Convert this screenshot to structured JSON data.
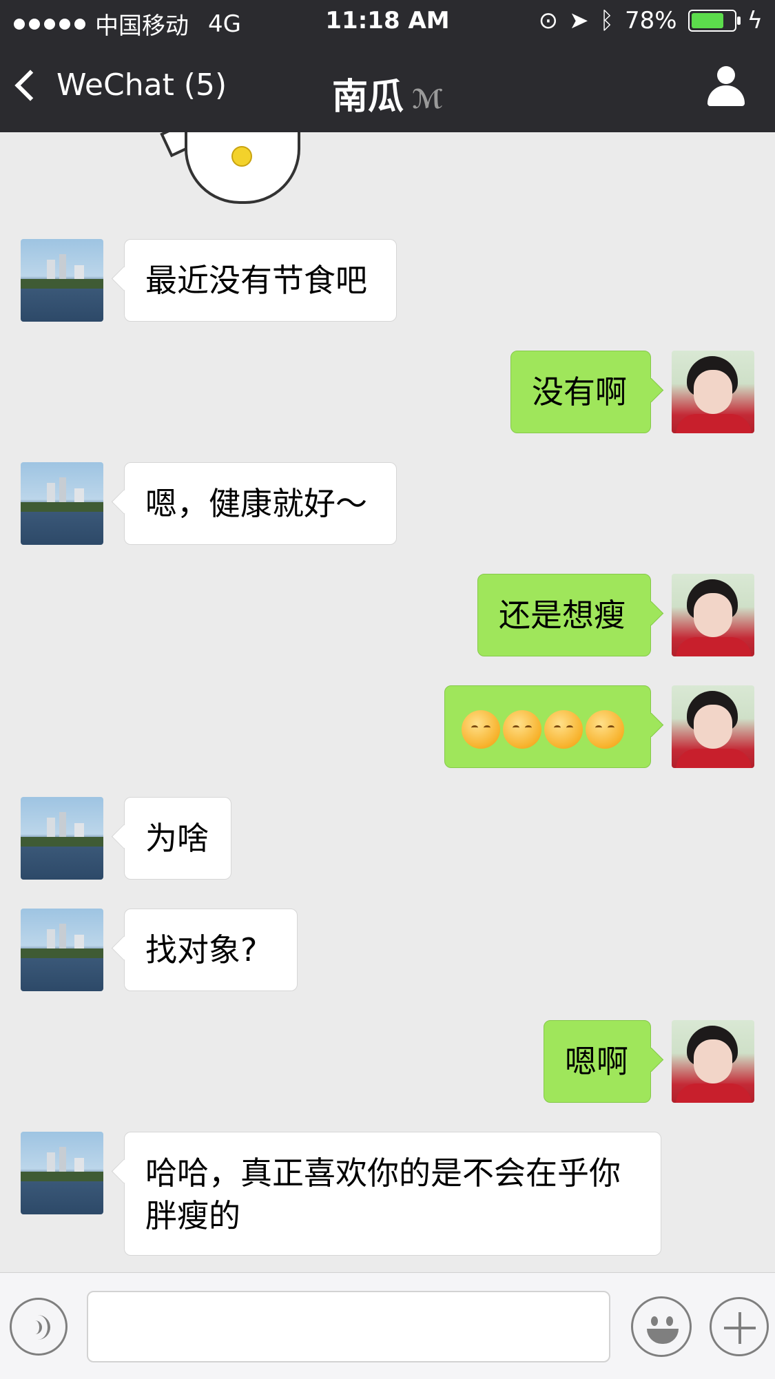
{
  "status_bar": {
    "carrier": "中国移动",
    "network": "4G",
    "time": "11:18 AM",
    "battery": "78%",
    "battery_level": 0.78
  },
  "nav": {
    "back_label": "WeChat (5)",
    "title": "南瓜"
  },
  "messages": [
    {
      "side": "left",
      "text": "最近没有节食吧"
    },
    {
      "side": "right",
      "text": "没有啊"
    },
    {
      "side": "left",
      "text": "嗯，健康就好～"
    },
    {
      "side": "right",
      "text": "还是想瘦"
    },
    {
      "side": "right",
      "type": "emoji",
      "emoji_name": "relieved-face",
      "count": 4
    },
    {
      "side": "left",
      "text": "为啥"
    },
    {
      "side": "left",
      "text": "找对象?"
    },
    {
      "side": "right",
      "text": "嗯啊"
    },
    {
      "side": "left",
      "text": "哈哈，真正喜欢你的是不会在乎你\n胖瘦的"
    }
  ],
  "input_bar": {
    "icons": [
      "voice-icon",
      "emoji-icon",
      "plus-icon"
    ],
    "text": ""
  },
  "colors": {
    "nav_bg": "#2b2b2f",
    "chat_bg": "#ebebeb",
    "sent_bubble": "#9fe65b",
    "received_bubble": "#ffffff",
    "battery": "#5cdc4c"
  }
}
